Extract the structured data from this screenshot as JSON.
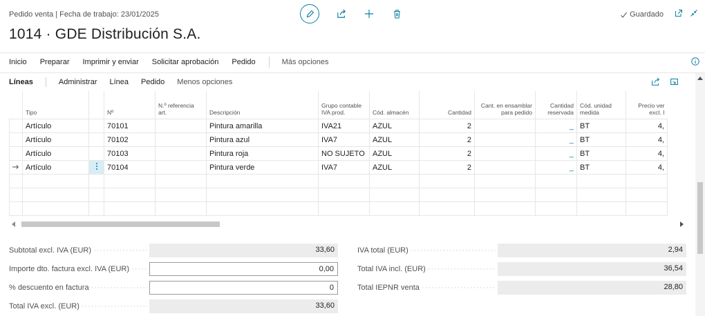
{
  "header": {
    "subtitle": "Pedido venta | Fecha de trabajo: 23/01/2025",
    "title": "1014 · GDE Distribución S.A.",
    "saved_label": "Guardado"
  },
  "menu": {
    "items": [
      "Inicio",
      "Preparar",
      "Imprimir y enviar",
      "Solicitar aprobación",
      "Pedido"
    ],
    "more": "Más opciones"
  },
  "lines": {
    "title": "Líneas",
    "actions": [
      "Administrar",
      "Línea",
      "Pedido"
    ],
    "less": "Menos opciones"
  },
  "table": {
    "columns": {
      "tipo": "Tipo",
      "no": "Nº",
      "ref": "N.º referencia art.",
      "desc": "Descripción",
      "iva": "Grupo contable IVA prod.",
      "almacen": "Cód. almacén",
      "cantidad": "Cantidad",
      "ensamblar": "Cant. en ensamblar para pedido",
      "reservada": "Cantidad reservada",
      "unidad": "Cód. unidad medida",
      "precio": "Precio ver excl. I"
    },
    "rows": [
      {
        "tipo": "Artículo",
        "no": "70101",
        "desc": "Pintura amarilla",
        "iva": "IVA21",
        "almacen": "AZUL",
        "cantidad": "2",
        "reservada": "_",
        "unidad": "BT",
        "precio": "4,"
      },
      {
        "tipo": "Artículo",
        "no": "70102",
        "desc": "Pintura azul",
        "iva": "IVA7",
        "almacen": "AZUL",
        "cantidad": "2",
        "reservada": "_",
        "unidad": "BT",
        "precio": "4,"
      },
      {
        "tipo": "Artículo",
        "no": "70103",
        "desc": "Pintura roja",
        "iva": "NO SUJETO",
        "almacen": "AZUL",
        "cantidad": "2",
        "reservada": "_",
        "unidad": "BT",
        "precio": "4,"
      },
      {
        "tipo": "Artículo",
        "no": "70104",
        "desc": "Pintura verde",
        "iva": "IVA7",
        "almacen": "AZUL",
        "cantidad": "2",
        "reservada": "_",
        "unidad": "BT",
        "precio": "4,"
      }
    ]
  },
  "totals": {
    "subtotal_label": "Subtotal excl. IVA (EUR)",
    "subtotal_value": "33,60",
    "dto_label": "Importe dto. factura excl. IVA (EUR)",
    "dto_value": "0,00",
    "pct_label": "% descuento en factura",
    "pct_value": "0",
    "total_excl_label": "Total IVA excl. (EUR)",
    "total_excl_value": "33,60",
    "iva_label": "IVA total (EUR)",
    "iva_value": "2,94",
    "total_incl_label": "Total IVA incl. (EUR)",
    "total_incl_value": "36,54",
    "iepnr_label": "Total IEPNR venta",
    "iepnr_value": "28,80"
  },
  "colors": {
    "accent": "#0a7ea4",
    "readonly_bg": "#ececec"
  }
}
